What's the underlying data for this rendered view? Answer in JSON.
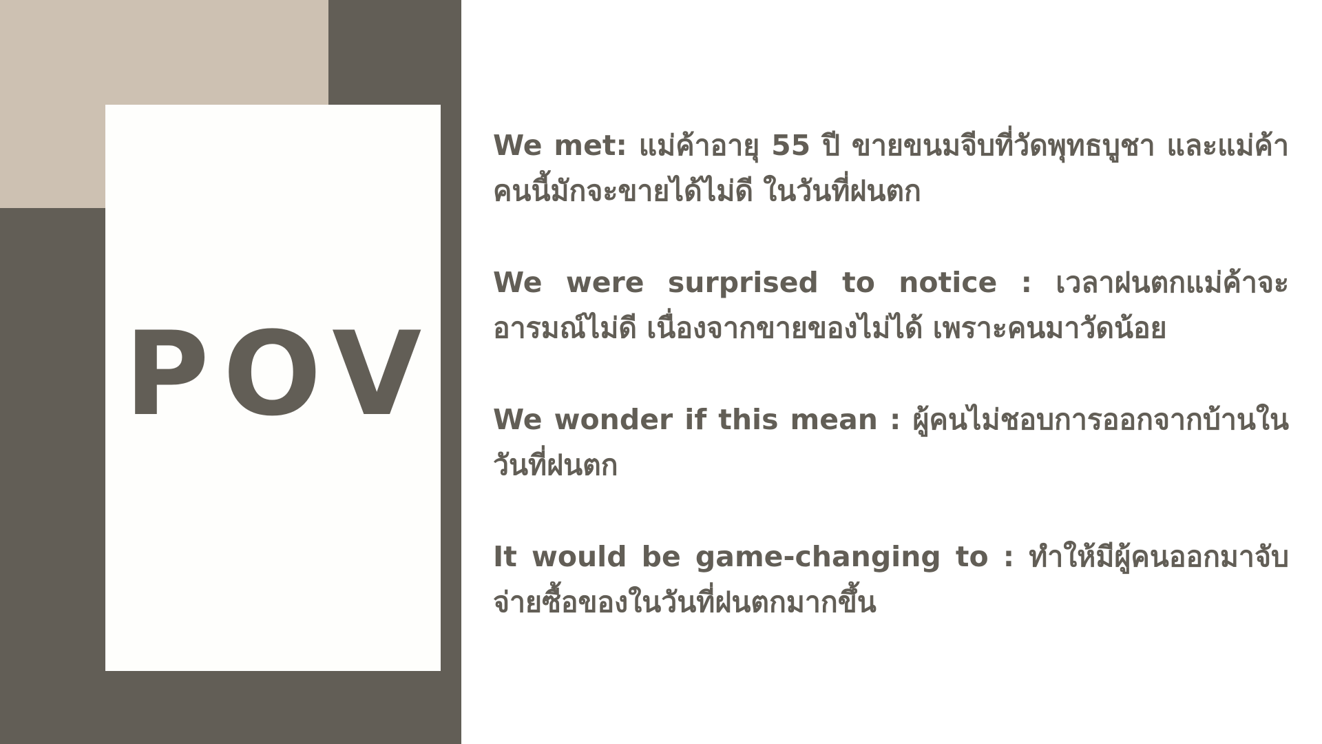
{
  "card": {
    "title": "POV"
  },
  "statements": [
    "We met: แม่ค้าอายุ 55 ปี ขายขนมจีบที่วัดพุทธบูชา และแม่ค้าคนนี้มักจะขายได้ไม่ดี ในวันที่ฝนตก",
    "We were surprised to notice : เวลาฝนตกแม่ค้าจะอารมณ์ไม่ดี เนื่องจากขายของไม่ได้ เพราะคนมาวัดน้อย",
    "We wonder if this mean :  ผู้คนไม่ชอบการออกจากบ้านในวันที่ฝนตก",
    "It would be game-changing to : ทำให้มีผู้คนออกมาจับจ่ายซื้อของในวันที่ฝนตกมากขึ้น"
  ],
  "colors": {
    "dark_panel": "#625e56",
    "beige_block": "#cdc1b2",
    "card": "#fefefc",
    "text": "#625e56",
    "background": "#ffffff"
  }
}
